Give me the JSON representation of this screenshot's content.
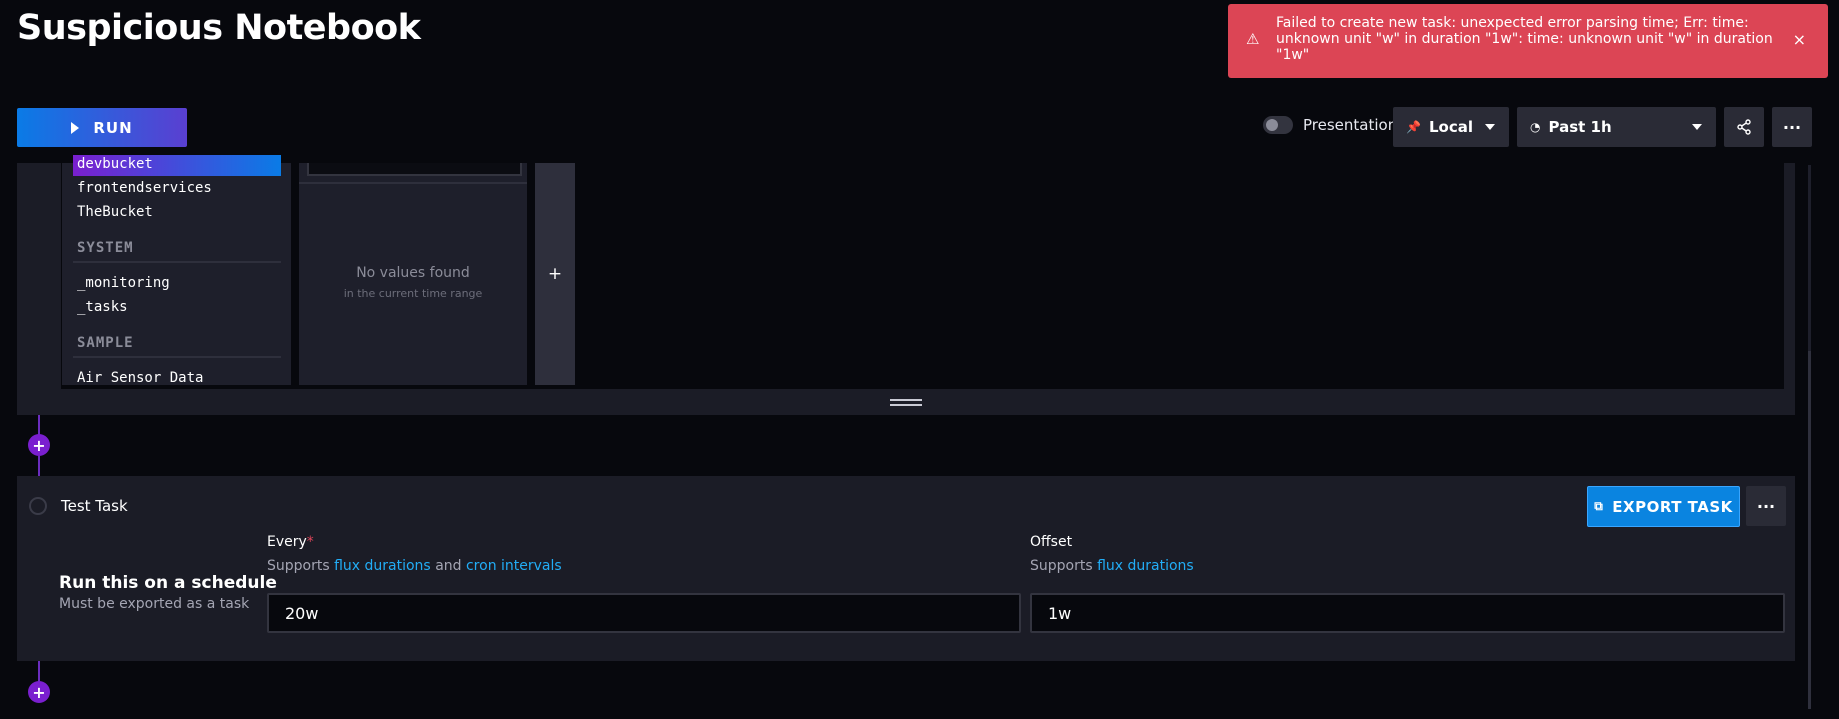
{
  "app": {
    "title": "Suspicious Notebook"
  },
  "toast": {
    "message": "Failed to create new task: unexpected error parsing time; Err: time: unknown unit \"w\" in duration \"1w\": time: unknown unit \"w\" in duration \"1w\"",
    "warning_icon": "⚠",
    "close_icon": "×"
  },
  "toolbar": {
    "run_label": "RUN",
    "presentation_label": "Presentation",
    "timezone_label": "Local",
    "timezone_icon": "📌",
    "range_label": "Past 1h",
    "range_icon": "◔",
    "share_icon": "share-icon",
    "more_icon": "···"
  },
  "buckets": {
    "user": [
      "devbucket",
      "frontendservices",
      "TheBucket"
    ],
    "selected": "devbucket",
    "system_header": "SYSTEM",
    "system": [
      "_monitoring",
      "_tasks"
    ],
    "sample_header": "SAMPLE",
    "sample": [
      "Air Sensor Data"
    ]
  },
  "values": {
    "empty_title": "No values found",
    "empty_sub": "in the current time range"
  },
  "add_column_icon": "+",
  "add_cell_icon": "+",
  "task": {
    "name": "Test Task",
    "export_label": "EXPORT TASK",
    "export_icon": "⧉",
    "more_icon": "···",
    "schedule_title": "Run this on a schedule",
    "schedule_sub": "Must be exported as a task",
    "every": {
      "label": "Every",
      "required": "*",
      "help_prefix": "Supports",
      "link1": "flux durations",
      "and": "and",
      "link2": "cron intervals",
      "value": "20w"
    },
    "offset": {
      "label": "Offset",
      "help_prefix": "Supports",
      "link1": "flux durations",
      "value": "1w"
    }
  },
  "colors": {
    "toast_bg": "#dc4555",
    "accent_purple": "#7a1fcf",
    "accent_blue": "#0a84e0",
    "link": "#22adf6"
  }
}
